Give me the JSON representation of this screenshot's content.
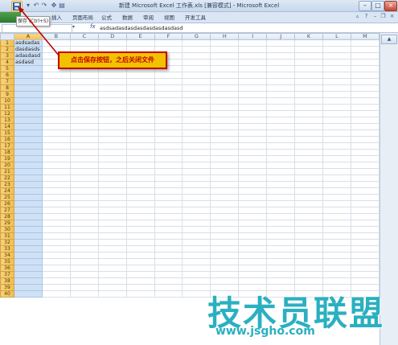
{
  "window": {
    "title": "新建 Microsoft Excel 工作表.xls [兼容模式] - Microsoft Excel"
  },
  "ribbon": {
    "file_tab": "文件",
    "tabs": [
      "插入",
      "页面布局",
      "公式",
      "数据",
      "审阅",
      "视图",
      "开发工具"
    ]
  },
  "tooltip": {
    "text": "保存 (Ctrl+S)"
  },
  "formula_bar": {
    "namebox_value": "",
    "fx_label": "fx",
    "content": "asdsadasdasdasdasdasdasdasd"
  },
  "sheet": {
    "columns": [
      "A",
      "B",
      "C",
      "D",
      "E",
      "F",
      "G",
      "H",
      "I",
      "J",
      "K",
      "L",
      "M"
    ],
    "rows": [
      "1",
      "2",
      "3",
      "4",
      "5",
      "6",
      "7",
      "8",
      "9",
      "10",
      "11",
      "12",
      "13",
      "14",
      "15",
      "16",
      "17",
      "18",
      "19",
      "20",
      "21",
      "22",
      "23",
      "24",
      "25",
      "26",
      "27",
      "28",
      "29",
      "30",
      "31",
      "32",
      "33",
      "34",
      "35",
      "36",
      "37",
      "38",
      "39",
      "40"
    ],
    "cells_A": [
      "asdsadas\ndasdasds\nadasdasd\nasdasd"
    ]
  },
  "callout": {
    "text": "点击保存按钮，之后关闭文件"
  },
  "watermark": {
    "text": "技术员联盟",
    "url": "www.jsgho.com"
  },
  "colors": {
    "callout_bg": "#f2c200",
    "callout_border": "#c40000",
    "selected_column": "#cfe1f5",
    "row_header": "#efc052",
    "watermark": "#2ab0c0"
  }
}
